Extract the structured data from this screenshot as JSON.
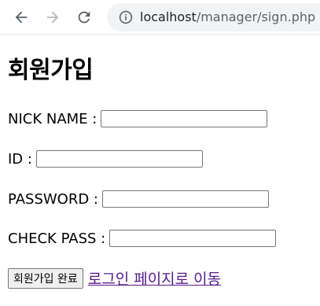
{
  "browser": {
    "url_host": "localhost",
    "url_path": "/manager/sign.php",
    "icons": {
      "back": "arrow-back-icon",
      "forward": "arrow-forward-icon",
      "reload": "reload-icon",
      "info": "info-icon"
    }
  },
  "page": {
    "title": "회원가입",
    "fields": {
      "nick": {
        "label": "NICK NAME :",
        "value": ""
      },
      "id": {
        "label": "ID :",
        "value": ""
      },
      "password": {
        "label": "PASSWORD :",
        "value": ""
      },
      "check_pass": {
        "label": "CHECK PASS :",
        "value": ""
      }
    },
    "submit_label": "회원가입 완료",
    "login_link_text": "로그인 페이지로 이동"
  },
  "colors": {
    "link_visited": "#551a8b",
    "omnibox_bg": "#f1f3f4",
    "icon_gray": "#5f6368"
  }
}
